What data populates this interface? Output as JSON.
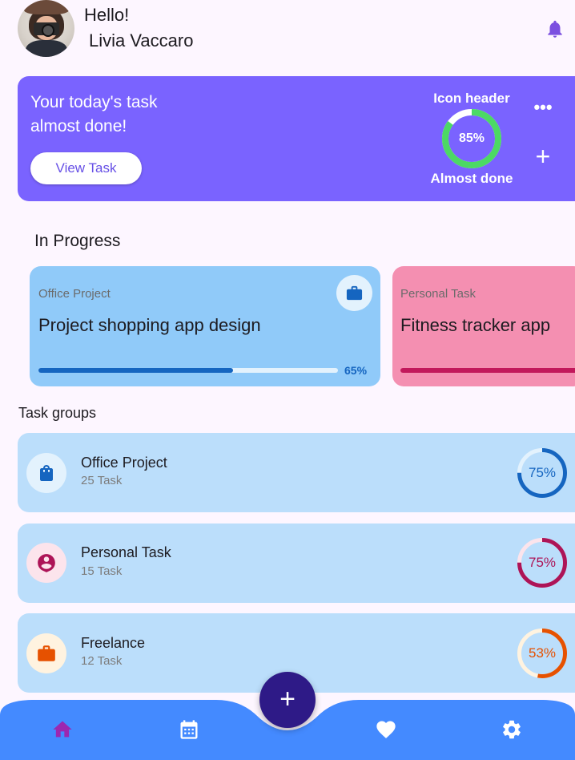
{
  "header": {
    "greeting": "Hello!",
    "user_name": "Livia Vaccaro",
    "bell_icon": "bell-icon",
    "bell_color": "#7b4fe0"
  },
  "summary": {
    "title": "Your today's task\n almost done!",
    "button_label": "View Task",
    "icon_header": "Icon header",
    "progress_text": "85%",
    "progress": 0.85,
    "status": "Almost done",
    "more_label": "•••",
    "plus_label": "+",
    "bg_color": "#7a63ff",
    "ring_color": "#4cd964"
  },
  "in_progress": {
    "title": "In Progress",
    "cards": [
      {
        "category": "Office Project",
        "title": "Project shopping app design",
        "progress": 0.65,
        "progress_text": "65%",
        "icon": "briefcase-icon"
      },
      {
        "category": "Personal Task",
        "title": "Fitness tracker app",
        "progress": 1.0
      }
    ]
  },
  "task_groups": {
    "title": "Task groups",
    "items": [
      {
        "name": "Office Project",
        "count": "25 Task",
        "progress": 0.75,
        "progress_text": "75%",
        "icon": "shopping-bag-icon",
        "color": "#1565c0",
        "bubble": "#e3f2fd",
        "ring_track": "#e3f2fd"
      },
      {
        "name": "Personal Task",
        "count": "15 Task",
        "progress": 0.75,
        "progress_text": "75%",
        "icon": "person-pin-icon",
        "color": "#ad1457",
        "bubble": "#fce4ec",
        "ring_track": "#fce4ec"
      },
      {
        "name": "Freelance",
        "count": "12 Task",
        "progress": 0.53,
        "progress_text": "53%",
        "icon": "briefcase-icon",
        "color": "#e65100",
        "bubble": "#fff3e0",
        "ring_track": "#fff3e0"
      }
    ]
  },
  "nav": {
    "items": [
      "home-icon",
      "calendar-icon",
      "heart-icon",
      "settings-icon"
    ],
    "fab_label": "+",
    "active_color": "#9c27b0",
    "bar_color": "#448aff"
  }
}
